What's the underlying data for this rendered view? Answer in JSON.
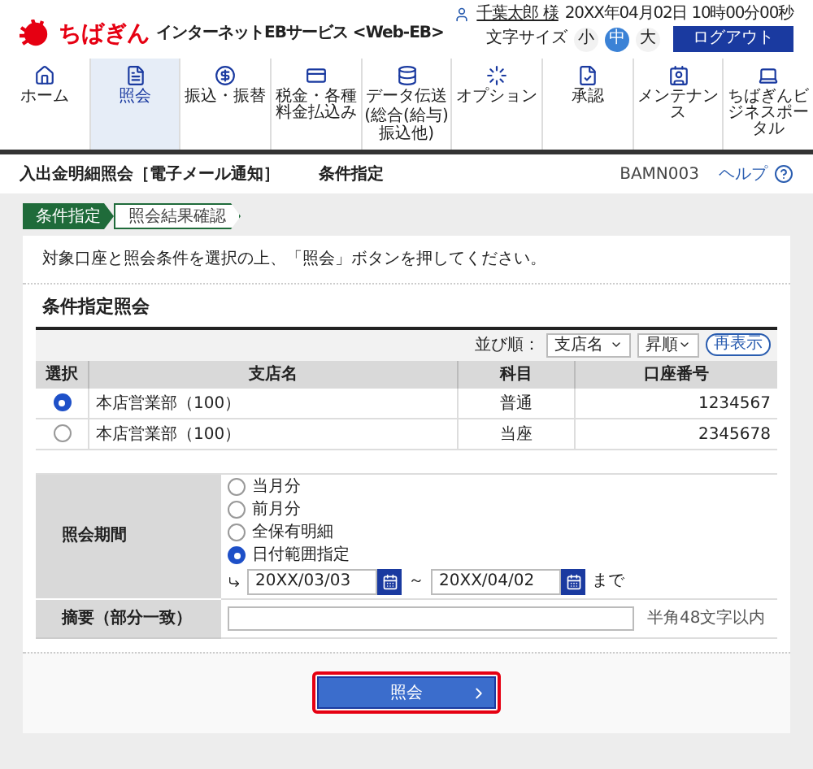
{
  "header": {
    "logo_text": "ちばぎん",
    "service_name": "インターネットEBサービス <Web-EB>",
    "user_name": "千葉太郎 様",
    "datetime": "20XX年04月02日 10時00分00秒",
    "font_size_label": "文字サイズ",
    "font_sizes": [
      {
        "label": "小",
        "selected": false
      },
      {
        "label": "中",
        "selected": true
      },
      {
        "label": "大",
        "selected": false
      }
    ],
    "logout": "ログアウト"
  },
  "nav": [
    {
      "label": "ホーム",
      "selected": false
    },
    {
      "label": "照会",
      "selected": true
    },
    {
      "label": "振込・振替",
      "selected": false
    },
    {
      "label": "税金・各種料金払込み",
      "selected": false
    },
    {
      "label": "データ伝送",
      "sublabel": "(総合(給与)振込他)",
      "selected": false
    },
    {
      "label": "オプション",
      "selected": false
    },
    {
      "label": "承認",
      "selected": false
    },
    {
      "label": "メンテナンス",
      "selected": false
    },
    {
      "label": "ちばぎんビジネスポータル",
      "selected": false
    }
  ],
  "title_bar": {
    "title": "入出金明細照会［電子メール通知］",
    "subtitle": "条件指定",
    "screen_id": "BAMN003",
    "help": "ヘルプ"
  },
  "steps": [
    {
      "label": "条件指定",
      "selected": true
    },
    {
      "label": "照会結果確認",
      "selected": false
    }
  ],
  "instruction": "対象口座と照会条件を選択の上、「照会」ボタンを押してください。",
  "section_title": "条件指定照会",
  "sort": {
    "label": "並び順：",
    "field": "支店名",
    "order": "昇順",
    "refresh": "再表示"
  },
  "table": {
    "columns": [
      "選択",
      "支店名",
      "科目",
      "口座番号"
    ],
    "rows": [
      {
        "selected": true,
        "branch": "本店営業部（100）",
        "subject": "普通",
        "account": "1234567"
      },
      {
        "selected": false,
        "branch": "本店営業部（100）",
        "subject": "当座",
        "account": "2345678"
      }
    ]
  },
  "period": {
    "label": "照会期間",
    "options": [
      {
        "label": "当月分",
        "selected": false
      },
      {
        "label": "前月分",
        "selected": false
      },
      {
        "label": "全保有明細",
        "selected": false
      },
      {
        "label": "日付範囲指定",
        "selected": true
      }
    ],
    "from": "20XX/03/03",
    "separator": "～",
    "to": "20XX/04/02",
    "suffix": "まで"
  },
  "summary": {
    "label": "摘要（部分一致）",
    "hint": "半角48文字以内"
  },
  "submit": "照会"
}
